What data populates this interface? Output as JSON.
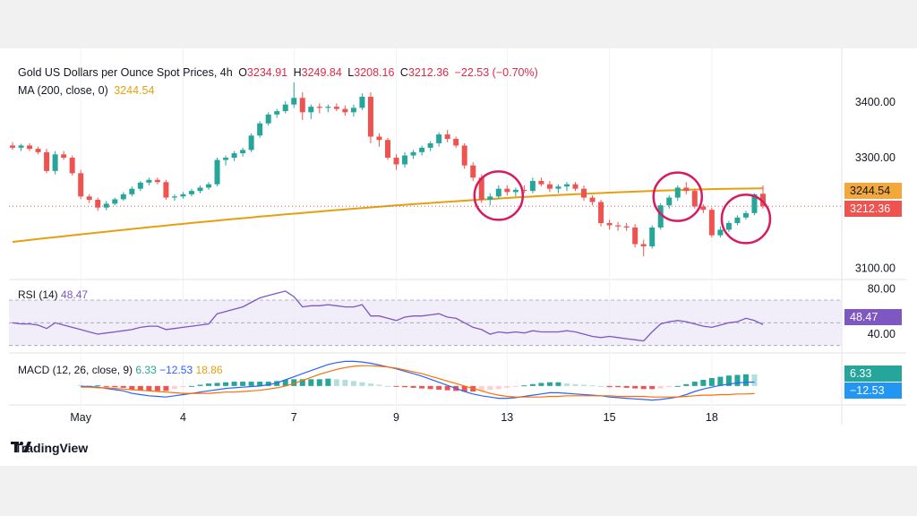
{
  "header": {
    "symbol": "Gold US Dollars per Ounce Spot Prices, 4h",
    "o_label": "O",
    "o_value": "3234.91",
    "h_label": "H",
    "h_value": "3249.84",
    "l_label": "L",
    "l_value": "3208.16",
    "c_label": "C",
    "c_value": "3212.36",
    "change": "−22.53 (−0.70%)"
  },
  "ma_legend": {
    "label": "MA (200, close, 0)",
    "value": "3244.54"
  },
  "rsi_legend": {
    "label": "RSI (14)",
    "value": "48.47"
  },
  "macd_legend": {
    "label": "MACD (12, 26, close, 9)",
    "macd": "6.33",
    "signal": "−12.53",
    "hist": "18.86"
  },
  "tags": {
    "ma": "3244.54",
    "price": "3212.36",
    "rsi": "48.47",
    "macd": "6.33",
    "signal": "−12.53"
  },
  "colors": {
    "up": "#26a69a",
    "down": "#ef5350",
    "ma": "#e6a00f",
    "rsi": "#7e57c2",
    "macd": "#2962ff",
    "signal": "#ff6d00",
    "highlight": "#d81b60"
  },
  "brand": "TradingView",
  "chart_data": {
    "type": "candlestick",
    "price_axis": {
      "ticks": [
        3100,
        3200,
        3300,
        3400
      ],
      "labels": [
        "3100.00",
        "3200.00",
        "3300.00",
        "3400.00"
      ],
      "range": [
        3085,
        3465
      ]
    },
    "x_axis": {
      "labels": [
        "May",
        "4",
        "7",
        "9",
        "13",
        "15",
        "18"
      ],
      "label_index": [
        8,
        20,
        33,
        45,
        58,
        70,
        82
      ]
    },
    "candles": [
      [
        3322,
        3328,
        3314,
        3318
      ],
      [
        3318,
        3325,
        3312,
        3322
      ],
      [
        3322,
        3326,
        3312,
        3316
      ],
      [
        3316,
        3320,
        3306,
        3310
      ],
      [
        3310,
        3316,
        3272,
        3276
      ],
      [
        3276,
        3312,
        3270,
        3306
      ],
      [
        3306,
        3312,
        3296,
        3300
      ],
      [
        3300,
        3304,
        3268,
        3272
      ],
      [
        3272,
        3278,
        3225,
        3230
      ],
      [
        3230,
        3234,
        3218,
        3224
      ],
      [
        3224,
        3228,
        3204,
        3210
      ],
      [
        3210,
        3222,
        3205,
        3217
      ],
      [
        3217,
        3228,
        3214,
        3225
      ],
      [
        3225,
        3238,
        3222,
        3234
      ],
      [
        3234,
        3248,
        3230,
        3244
      ],
      [
        3244,
        3258,
        3240,
        3255
      ],
      [
        3255,
        3264,
        3250,
        3260
      ],
      [
        3260,
        3264,
        3252,
        3256
      ],
      [
        3256,
        3260,
        3224,
        3228
      ],
      [
        3228,
        3234,
        3222,
        3230
      ],
      [
        3230,
        3238,
        3226,
        3234
      ],
      [
        3234,
        3244,
        3230,
        3240
      ],
      [
        3240,
        3250,
        3236,
        3246
      ],
      [
        3246,
        3256,
        3242,
        3252
      ],
      [
        3252,
        3300,
        3248,
        3296
      ],
      [
        3296,
        3304,
        3286,
        3300
      ],
      [
        3300,
        3312,
        3294,
        3308
      ],
      [
        3308,
        3318,
        3302,
        3314
      ],
      [
        3314,
        3344,
        3310,
        3340
      ],
      [
        3340,
        3366,
        3336,
        3362
      ],
      [
        3362,
        3382,
        3358,
        3378
      ],
      [
        3378,
        3388,
        3372,
        3384
      ],
      [
        3384,
        3402,
        3380,
        3396
      ],
      [
        3396,
        3436,
        3390,
        3408
      ],
      [
        3408,
        3418,
        3368,
        3382
      ],
      [
        3382,
        3396,
        3370,
        3392
      ],
      [
        3392,
        3398,
        3380,
        3390
      ],
      [
        3390,
        3396,
        3382,
        3392
      ],
      [
        3392,
        3398,
        3384,
        3388
      ],
      [
        3388,
        3394,
        3376,
        3382
      ],
      [
        3382,
        3396,
        3374,
        3390
      ],
      [
        3390,
        3416,
        3386,
        3410
      ],
      [
        3410,
        3418,
        3326,
        3338
      ],
      [
        3338,
        3344,
        3320,
        3332
      ],
      [
        3332,
        3336,
        3296,
        3300
      ],
      [
        3300,
        3306,
        3278,
        3288
      ],
      [
        3288,
        3310,
        3282,
        3304
      ],
      [
        3304,
        3314,
        3298,
        3310
      ],
      [
        3310,
        3322,
        3304,
        3318
      ],
      [
        3318,
        3330,
        3312,
        3326
      ],
      [
        3326,
        3346,
        3320,
        3342
      ],
      [
        3342,
        3350,
        3328,
        3334
      ],
      [
        3334,
        3338,
        3318,
        3322
      ],
      [
        3322,
        3326,
        3280,
        3286
      ],
      [
        3286,
        3292,
        3258,
        3264
      ],
      [
        3264,
        3270,
        3218,
        3224
      ],
      [
        3224,
        3236,
        3214,
        3230
      ],
      [
        3230,
        3250,
        3226,
        3244
      ],
      [
        3244,
        3250,
        3232,
        3238
      ],
      [
        3238,
        3246,
        3230,
        3242
      ],
      [
        3242,
        3250,
        3236,
        3240
      ],
      [
        3240,
        3264,
        3236,
        3258
      ],
      [
        3258,
        3264,
        3248,
        3252
      ],
      [
        3252,
        3258,
        3238,
        3244
      ],
      [
        3244,
        3252,
        3236,
        3248
      ],
      [
        3248,
        3256,
        3240,
        3252
      ],
      [
        3252,
        3256,
        3240,
        3244
      ],
      [
        3244,
        3250,
        3222,
        3228
      ],
      [
        3228,
        3232,
        3214,
        3220
      ],
      [
        3220,
        3224,
        3176,
        3182
      ],
      [
        3182,
        3188,
        3170,
        3178
      ],
      [
        3178,
        3184,
        3168,
        3176
      ],
      [
        3176,
        3182,
        3168,
        3174
      ],
      [
        3174,
        3180,
        3138,
        3144
      ],
      [
        3144,
        3152,
        3122,
        3140
      ],
      [
        3140,
        3178,
        3136,
        3174
      ],
      [
        3174,
        3218,
        3170,
        3214
      ],
      [
        3214,
        3232,
        3208,
        3228
      ],
      [
        3228,
        3250,
        3222,
        3246
      ],
      [
        3246,
        3256,
        3234,
        3240
      ],
      [
        3240,
        3244,
        3208,
        3212
      ],
      [
        3212,
        3216,
        3200,
        3206
      ],
      [
        3206,
        3210,
        3156,
        3160
      ],
      [
        3160,
        3176,
        3156,
        3170
      ],
      [
        3170,
        3186,
        3166,
        3182
      ],
      [
        3182,
        3196,
        3178,
        3192
      ],
      [
        3192,
        3204,
        3188,
        3200
      ],
      [
        3200,
        3236,
        3196,
        3234
      ],
      [
        3234.91,
        3249.84,
        3208.16,
        3212.36
      ]
    ],
    "ma200": {
      "start": 3148,
      "end": 3244.54
    },
    "rsi": {
      "range": [
        25,
        85
      ],
      "levels": [
        30,
        50,
        70
      ],
      "ticks": [
        40,
        80
      ],
      "tick_labels": [
        "40.00",
        "80.00"
      ],
      "values": [
        50,
        49,
        49,
        48,
        45,
        50,
        48,
        46,
        44,
        42,
        40,
        41,
        42,
        43,
        44,
        46,
        47,
        47,
        44,
        45,
        46,
        47,
        48,
        49,
        58,
        60,
        62,
        64,
        68,
        72,
        74,
        76,
        78,
        73,
        64,
        65,
        65,
        66,
        65,
        64,
        64,
        66,
        56,
        56,
        54,
        52,
        55,
        56,
        56,
        57,
        58,
        55,
        54,
        50,
        46,
        44,
        40,
        42,
        41,
        42,
        41,
        43,
        42,
        42,
        42,
        43,
        42,
        40,
        38,
        37,
        38,
        37,
        36,
        35,
        34,
        42,
        49,
        51,
        52,
        51,
        49,
        47,
        46,
        48,
        50,
        51,
        54,
        52,
        48.47
      ]
    },
    "macd": {
      "macd_values": [
        -0.5,
        -1,
        -2,
        -4,
        -6,
        -8,
        -12,
        -14,
        -16,
        -17,
        -18,
        -16,
        -14,
        -12,
        -10,
        -8,
        -6,
        -4,
        -3,
        -2,
        -1,
        0,
        2,
        5,
        10,
        15,
        20,
        25,
        30,
        35,
        38,
        40,
        40,
        39,
        37,
        34,
        31,
        28,
        24,
        20,
        16,
        11,
        6,
        1,
        -4,
        -9,
        -13,
        -16,
        -18,
        -20,
        -20,
        -19,
        -17,
        -15,
        -13,
        -11,
        -11,
        -12,
        -13,
        -14,
        -15,
        -16,
        -18,
        -19,
        -20,
        -21,
        -22,
        -23,
        -22,
        -20,
        -18,
        -14,
        -9,
        -5,
        -2,
        1,
        3,
        5,
        6,
        6.33
      ],
      "signal_values": [
        -2,
        -2,
        -3,
        -3,
        -4,
        -5,
        -6,
        -7,
        -8,
        -9,
        -10,
        -11,
        -12,
        -12,
        -12,
        -12,
        -11,
        -10,
        -10,
        -9,
        -8,
        -7,
        -5,
        -3,
        0,
        4,
        9,
        14,
        19,
        23,
        27,
        30,
        32,
        33,
        33,
        32,
        31,
        29,
        26,
        23,
        20,
        16,
        12,
        8,
        4,
        0,
        -4,
        -8,
        -12,
        -15,
        -17,
        -18,
        -18,
        -18,
        -18,
        -17,
        -17,
        -16,
        -16,
        -16,
        -16,
        -16,
        -16,
        -17,
        -17,
        -17,
        -17,
        -18,
        -18,
        -18,
        -18,
        -17,
        -16,
        -15,
        -15,
        -14,
        -14,
        -13,
        -13,
        -12.53
      ],
      "hist_note": "18.86"
    },
    "highlight_circles_at_index": [
      57,
      78,
      86
    ]
  }
}
